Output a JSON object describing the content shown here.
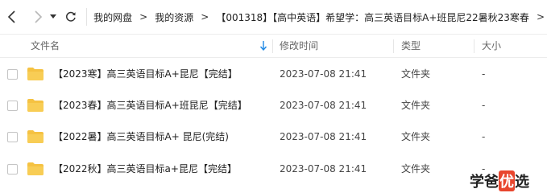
{
  "nav": {
    "breadcrumbs": [
      "我的网盘",
      "我的资源",
      "【001318】【高中英语】希望学：高三英语目标A+班昆尼22暑秋23寒春"
    ],
    "separator": ">"
  },
  "header": {
    "name": "文件名",
    "modified": "修改时间",
    "type": "类型",
    "size": "大小"
  },
  "rows": [
    {
      "name": "【2023寒】高三英语目标A+昆尼【完结】",
      "modified": "2023-07-08 21:41",
      "type": "文件夹",
      "size": "-"
    },
    {
      "name": "【2023春】高三英语目标A+班昆尼【完结】",
      "modified": "2023-07-08 21:41",
      "type": "文件夹",
      "size": "-"
    },
    {
      "name": "【2022暑】高三英语目标A+ 昆尼(完结)",
      "modified": "2023-07-08 21:41",
      "type": "文件夹",
      "size": "-"
    },
    {
      "name": "【2022秋】高三英语目标a+昆尼【完结】",
      "modified": "2023-07-08 21:41",
      "type": "文件夹",
      "size": "-"
    }
  ],
  "watermark": {
    "chars": [
      "学",
      "爸",
      "优",
      "选"
    ]
  },
  "colors": {
    "folder": "#f5c242",
    "sort_arrow": "#1e88e5",
    "logo_accent": "#e8462e"
  },
  "icons": {
    "back": "chevron-left-icon",
    "forward": "chevron-right-icon",
    "dropdown": "caret-down-icon",
    "refresh": "refresh-icon",
    "sort": "arrow-down-icon",
    "folder": "folder-icon"
  }
}
